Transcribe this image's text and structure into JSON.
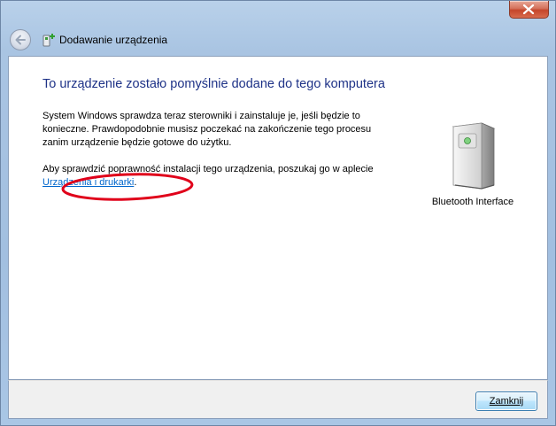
{
  "window": {
    "title": "Dodawanie urządzenia"
  },
  "content": {
    "heading": "To urządzenie zostało pomyślnie dodane do tego komputera",
    "paragraph1": "System Windows sprawdza teraz sterowniki i zainstaluje je, jeśli będzie to konieczne. Prawdopodobnie musisz poczekać na zakończenie tego procesu zanim urządzenie będzie gotowe do użytku.",
    "paragraph2_prefix": "Aby sprawdzić poprawność instalacji tego urządzenia, poszukaj go w aplecie ",
    "paragraph2_link": "Urządzenia i drukarki",
    "paragraph2_suffix": "."
  },
  "device": {
    "label": "Bluetooth Interface",
    "icon": "device-tower-icon"
  },
  "footer": {
    "close_label": "Zamknij"
  },
  "colors": {
    "heading": "#1e3287",
    "link": "#0066cc",
    "annotation": "#e0001a"
  }
}
